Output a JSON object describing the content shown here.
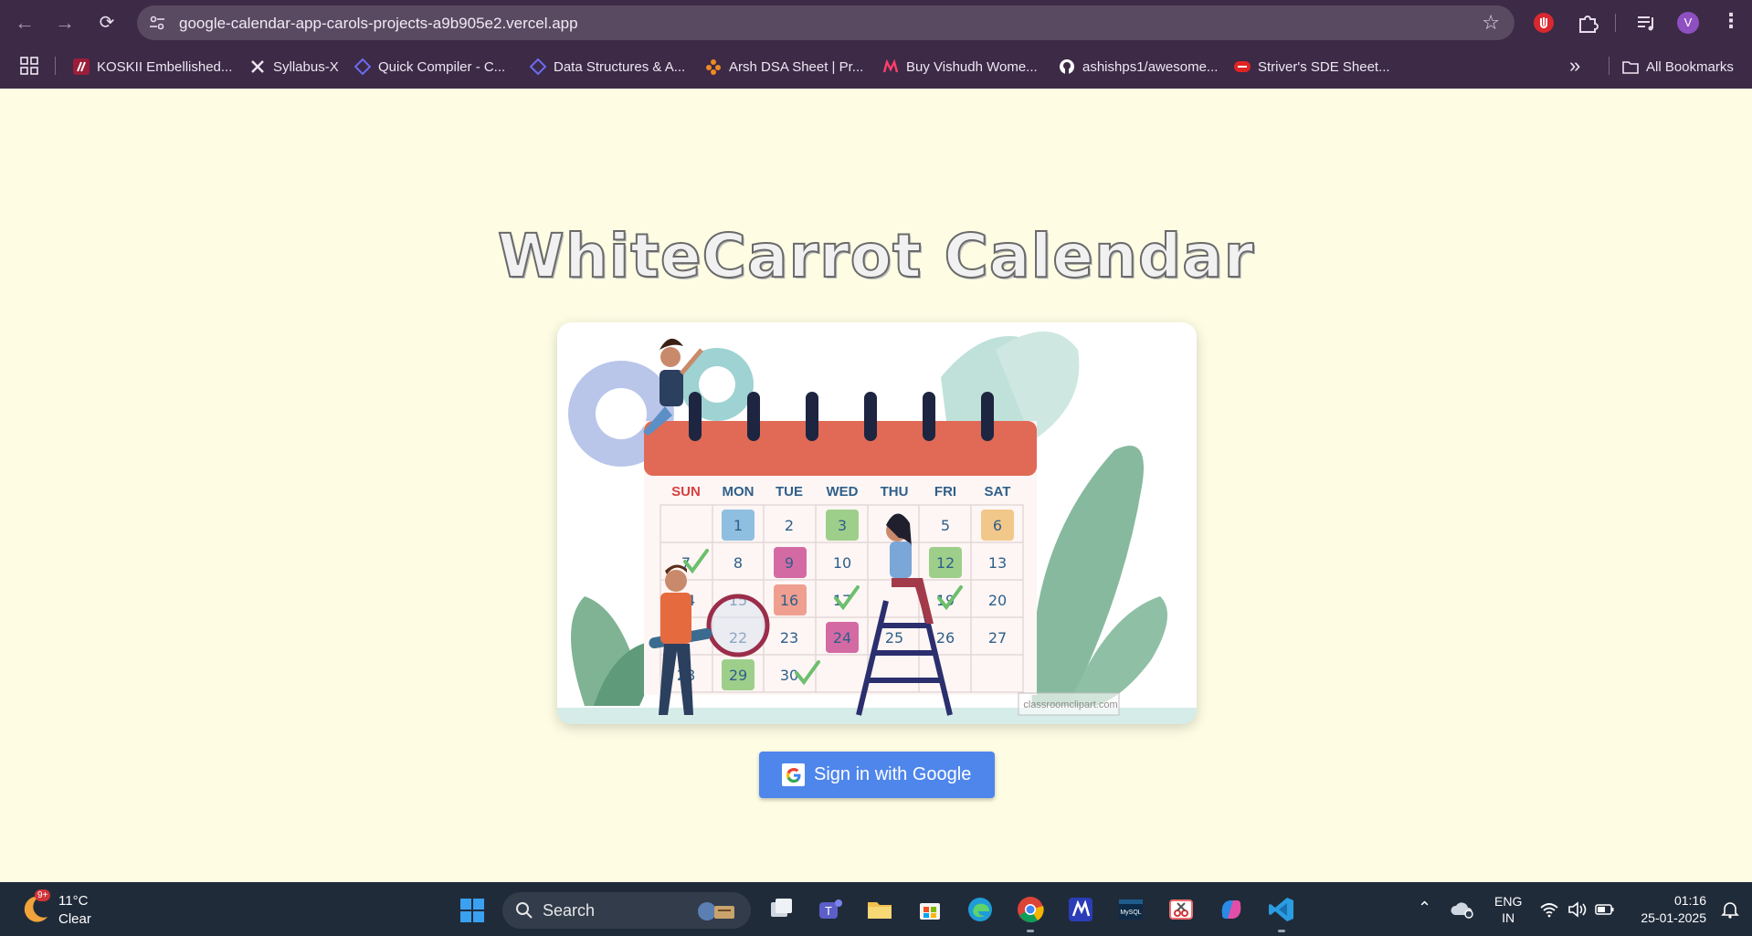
{
  "browser": {
    "url": "google-calendar-app-carols-projects-a9b905e2.vercel.app",
    "profile_initial": "V",
    "bookmarks": [
      {
        "label": "KOSKII Embellished...",
        "icon": "koskii-icon",
        "color": "#e0245e"
      },
      {
        "label": "Syllabus-X",
        "icon": "x-icon",
        "color": "#000000"
      },
      {
        "label": "Quick Compiler - C...",
        "icon": "diamond-icon",
        "color": "#5b5bd6"
      },
      {
        "label": "Data Structures & A...",
        "icon": "diamond-icon",
        "color": "#5b5bd6"
      },
      {
        "label": "Arsh DSA Sheet | Pr...",
        "icon": "flower-icon",
        "color": "#f08a24"
      },
      {
        "label": "Buy Vishudh Wome...",
        "icon": "myntra-icon",
        "color": "#ff3f6c"
      },
      {
        "label": "ashishps1/awesome...",
        "icon": "github-icon",
        "color": "#ffffff"
      },
      {
        "label": "Striver's SDE Sheet...",
        "icon": "tuf-icon",
        "color": "#e02424"
      }
    ],
    "all_bookmarks_label": "All Bookmarks"
  },
  "page": {
    "title": "WhiteCarrot Calendar",
    "signin_label": "Sign in with Google",
    "illustration": {
      "days": [
        "SUN",
        "MON",
        "TUE",
        "WED",
        "THU",
        "FRI",
        "SAT"
      ],
      "watermark": "classroomclipart.com"
    }
  },
  "taskbar": {
    "weather_badge": "9+",
    "temperature": "11°C",
    "condition": "Clear",
    "search_label": "Search",
    "lang_line1": "ENG",
    "lang_line2": "IN",
    "time": "01:16",
    "date": "25-01-2025"
  },
  "colors": {
    "chrome_bg": "#3c2a46",
    "page_bg": "#fefde4",
    "signin_blue": "#4f86ec",
    "taskbar_bg": "#202b3a"
  }
}
